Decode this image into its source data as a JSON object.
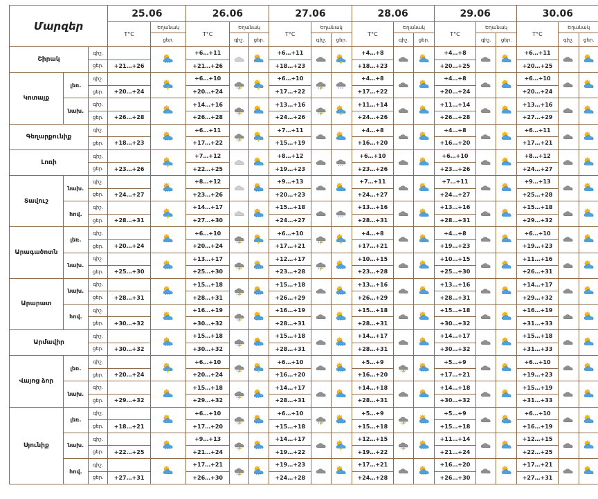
{
  "header": {
    "title": "Մարզեր",
    "days": [
      "25.06",
      "26.06",
      "27.06",
      "28.06",
      "29.06",
      "30.06"
    ],
    "temp_label": "T°C",
    "weather_label": "Եղանակ",
    "night_label": "գիշ.",
    "day_label": "ցեր."
  },
  "icon_names": {
    "s": "sun-behind-cloud-rain-icon",
    "sc": "sun-behind-cloud-icon",
    "c": "cloud-icon",
    "ct": "cloud-lightning-rain-icon",
    "cr": "cloud-rain-icon",
    "cl": "light-cloud-icon",
    "st": "sun-cloud-lightning-icon"
  },
  "rows": [
    {
      "region": "Շիրակ",
      "sub": "",
      "period": "գիշ.",
      "temps": [
        "",
        "+6…+11",
        "+6…+11",
        "+4…+8",
        "+4…+8",
        "+6…+11"
      ],
      "icons": [
        [
          "s"
        ],
        [
          "cl",
          "sc"
        ],
        [
          "c",
          "st"
        ],
        [
          "c",
          "sc"
        ],
        [
          "c",
          "sc"
        ],
        [
          "c",
          "sc"
        ]
      ]
    },
    {
      "region": "",
      "sub": "",
      "period": "ցեր.",
      "temps": [
        "+21…+26",
        "+21…+26",
        "+18…+23",
        "+18…+23",
        "+20…+25",
        "+20…+25"
      ],
      "icons": []
    },
    {
      "region": "Կոտայք",
      "sub": "լեռ.",
      "period": "գիշ.",
      "temps": [
        "",
        "+6…+10",
        "+6…+10",
        "+4…+8",
        "+4…+8",
        "+6…+10"
      ],
      "icons": [
        [
          "st"
        ],
        [
          "ct",
          "st"
        ],
        [
          "ct",
          "cr"
        ],
        [
          "c",
          "sc"
        ],
        [
          "c",
          "sc"
        ],
        [
          "c",
          "sc"
        ]
      ]
    },
    {
      "region": "",
      "sub": "",
      "period": "ցեր.",
      "temps": [
        "+20…+24",
        "+20…+24",
        "+17…+22",
        "+17…+22",
        "+20…+24",
        "+20…+24"
      ],
      "icons": []
    },
    {
      "region": "",
      "sub": "նախ.",
      "period": "գիշ.",
      "temps": [
        "",
        "+14…+16",
        "+13…+16",
        "+11…+14",
        "+11…+14",
        "+13…+16"
      ],
      "icons": [
        [
          "sc"
        ],
        [
          "ct",
          "sc"
        ],
        [
          "ct",
          "st"
        ],
        [
          "c",
          "sc"
        ],
        [
          "c",
          "sc"
        ],
        [
          "c",
          "sc"
        ]
      ]
    },
    {
      "region": "",
      "sub": "",
      "period": "ցեր.",
      "temps": [
        "+26…+28",
        "+26…+28",
        "+24…+26",
        "+24…+26",
        "+26…+28",
        "+27…+29"
      ],
      "icons": []
    },
    {
      "region": "Գեղարքունիք",
      "sub": "",
      "period": "գիշ.",
      "temps": [
        "",
        "+6…+11",
        "+7…+11",
        "+4…+8",
        "+4…+8",
        "+6…+11"
      ],
      "icons": [
        [
          "s"
        ],
        [
          "ct",
          "st"
        ],
        [
          "c",
          "sc"
        ],
        [
          "c",
          "sc"
        ],
        [
          "c",
          "sc"
        ],
        [
          "c",
          "sc"
        ]
      ]
    },
    {
      "region": "",
      "sub": "",
      "period": "ցեր.",
      "temps": [
        "+18…+23",
        "+17…+22",
        "+15…+19",
        "+16…+20",
        "+16…+20",
        "+17…+21"
      ],
      "icons": []
    },
    {
      "region": "Լոռի",
      "sub": "",
      "period": "գիշ.",
      "temps": [
        "",
        "+7…+12",
        "+8…+12",
        "+6…+10",
        "+6…+10",
        "+8…+12"
      ],
      "icons": [
        [
          "st"
        ],
        [
          "cl",
          "sc"
        ],
        [
          "c",
          "cr"
        ],
        [
          "c",
          "sc"
        ],
        [
          "c",
          "sc"
        ],
        [
          "c",
          "sc"
        ]
      ]
    },
    {
      "region": "",
      "sub": "",
      "period": "ցեր.",
      "temps": [
        "+23…+26",
        "+22…+25",
        "+19…+23",
        "+23…+26",
        "+23…+26",
        "+24…+27"
      ],
      "icons": []
    },
    {
      "region": "Տավուշ",
      "sub": "նախ.",
      "period": "գիշ.",
      "temps": [
        "",
        "+8…+12",
        "+9…+13",
        "+7…+11",
        "+7…+11",
        "+9…+13"
      ],
      "icons": [
        [
          "s"
        ],
        [
          "cl",
          "s"
        ],
        [
          "c",
          "sc"
        ],
        [
          "c",
          "sc"
        ],
        [
          "c",
          "sc"
        ],
        [
          "c",
          "sc"
        ]
      ]
    },
    {
      "region": "",
      "sub": "",
      "period": "ցեր.",
      "temps": [
        "+24…+27",
        "+23…+26",
        "+20…+23",
        "+24…+27",
        "+24…+27",
        "+25…+28"
      ],
      "icons": []
    },
    {
      "region": "",
      "sub": "հով.",
      "period": "գիշ.",
      "temps": [
        "",
        "+14…+17",
        "+15…+18",
        "+13…+16",
        "+13…+16",
        "+15…+18"
      ],
      "icons": [
        [
          "st"
        ],
        [
          "cl",
          "s"
        ],
        [
          "c",
          "cr"
        ],
        [
          "c",
          "sc"
        ],
        [
          "c",
          "sc"
        ],
        [
          "c",
          "sc"
        ]
      ]
    },
    {
      "region": "",
      "sub": "",
      "period": "ցեր.",
      "temps": [
        "+28…+31",
        "+27…+30",
        "+24…+27",
        "+28…+31",
        "+28…+31",
        "+29…+32"
      ],
      "icons": []
    },
    {
      "region": "Արագածոտն",
      "sub": "լեռ.",
      "period": "գիշ.",
      "temps": [
        "",
        "+6…+10",
        "+6…+10",
        "+4…+8",
        "+4…+8",
        "+6…+10"
      ],
      "icons": [
        [
          "sc"
        ],
        [
          "ct",
          "st"
        ],
        [
          "ct",
          "st"
        ],
        [
          "c",
          "sc"
        ],
        [
          "c",
          "sc"
        ],
        [
          "c",
          "sc"
        ]
      ]
    },
    {
      "region": "",
      "sub": "",
      "period": "ցեր.",
      "temps": [
        "+20…+24",
        "+20…+24",
        "+17…+21",
        "+17…+21",
        "+19…+23",
        "+19…+23"
      ],
      "icons": []
    },
    {
      "region": "",
      "sub": "նախ.",
      "period": "գիշ.",
      "temps": [
        "",
        "+13…+17",
        "+12…+17",
        "+10…+15",
        "+10…+15",
        "+11…+16"
      ],
      "icons": [
        [
          "s"
        ],
        [
          "ct",
          "s"
        ],
        [
          "ct",
          "s"
        ],
        [
          "c",
          "sc"
        ],
        [
          "c",
          "sc"
        ],
        [
          "c",
          "sc"
        ]
      ]
    },
    {
      "region": "",
      "sub": "",
      "period": "ցեր.",
      "temps": [
        "+25…+30",
        "+25…+30",
        "+23…+28",
        "+23…+28",
        "+25…+30",
        "+26…+31"
      ],
      "icons": []
    },
    {
      "region": "Արարատ",
      "sub": "նախ.",
      "period": "գիշ.",
      "temps": [
        "",
        "+15…+18",
        "+15…+18",
        "+13…+16",
        "+13…+16",
        "+14…+17"
      ],
      "icons": [
        [
          "s"
        ],
        [
          "ct",
          "s"
        ],
        [
          "c",
          "s"
        ],
        [
          "c",
          "sc"
        ],
        [
          "c",
          "sc"
        ],
        [
          "c",
          "sc"
        ]
      ]
    },
    {
      "region": "",
      "sub": "",
      "period": "ցեր.",
      "temps": [
        "+28…+31",
        "+28…+31",
        "+26…+29",
        "+26…+29",
        "+28…+31",
        "+29…+32"
      ],
      "icons": []
    },
    {
      "region": "",
      "sub": "հով.",
      "period": "գիշ.",
      "temps": [
        "",
        "+16…+19",
        "+16…+19",
        "+15…+18",
        "+15…+18",
        "+16…+19"
      ],
      "icons": [
        [
          "sc"
        ],
        [
          "ct",
          "s"
        ],
        [
          "c",
          "s"
        ],
        [
          "c",
          "sc"
        ],
        [
          "c",
          "sc"
        ],
        [
          "c",
          "sc"
        ]
      ]
    },
    {
      "region": "",
      "sub": "",
      "period": "ցեր.",
      "temps": [
        "+30…+32",
        "+30…+32",
        "+28…+31",
        "+28…+31",
        "+30…+32",
        "+31…+33"
      ],
      "icons": []
    },
    {
      "region": "Արմավիր",
      "sub": "",
      "period": "գիշ.",
      "temps": [
        "",
        "+15…+18",
        "+15…+18",
        "+14…+17",
        "+14…+17",
        "+15…+18"
      ],
      "icons": [
        [
          "s"
        ],
        [
          "ct",
          "s"
        ],
        [
          "c",
          "s"
        ],
        [
          "c",
          "sc"
        ],
        [
          "c",
          "sc"
        ],
        [
          "c",
          "sc"
        ]
      ]
    },
    {
      "region": "",
      "sub": "",
      "period": "ցեր.",
      "temps": [
        "+30…+32",
        "+30…+32",
        "+28…+31",
        "+28…+31",
        "+30…+32",
        "+31…+33"
      ],
      "icons": []
    },
    {
      "region": "Վայոց ձոր",
      "sub": "լեռ.",
      "period": "գիշ.",
      "temps": [
        "",
        "+6…+10",
        "+6…+10",
        "+5…+9",
        "+5…+9",
        "+6…+10"
      ],
      "icons": [
        [
          "st"
        ],
        [
          "ct",
          "st"
        ],
        [
          "c",
          "s"
        ],
        [
          "ct",
          "s"
        ],
        [
          "c",
          "sc"
        ],
        [
          "c",
          "sc"
        ]
      ]
    },
    {
      "region": "",
      "sub": "",
      "period": "ցեր.",
      "temps": [
        "+20…+24",
        "+20…+24",
        "+16…+20",
        "+16…+20",
        "+17…+21",
        "+19…+23"
      ],
      "icons": []
    },
    {
      "region": "",
      "sub": "նախ.",
      "period": "գիշ.",
      "temps": [
        "",
        "+15…+18",
        "+14…+17",
        "+14…+18",
        "+14…+18",
        "+15…+19"
      ],
      "icons": [
        [
          "sc"
        ],
        [
          "ct",
          "s"
        ],
        [
          "c",
          "sc"
        ],
        [
          "c",
          "sc"
        ],
        [
          "c",
          "sc"
        ],
        [
          "c",
          "sc"
        ]
      ]
    },
    {
      "region": "",
      "sub": "",
      "period": "ցեր.",
      "temps": [
        "+29…+32",
        "+29…+32",
        "+28…+31",
        "+28…+31",
        "+30…+32",
        "+31…+33"
      ],
      "icons": []
    },
    {
      "region": "Սյունիք",
      "sub": "լեռ.",
      "period": "գիշ.",
      "temps": [
        "",
        "+6…+10",
        "+6…+10",
        "+5…+9",
        "+5…+9",
        "+6…+10"
      ],
      "icons": [
        [
          "sc"
        ],
        [
          "ct",
          "s"
        ],
        [
          "ct",
          "s"
        ],
        [
          "ct",
          "s"
        ],
        [
          "c",
          "s"
        ],
        [
          "c",
          "sc"
        ]
      ]
    },
    {
      "region": "",
      "sub": "",
      "period": "ցեր.",
      "temps": [
        "+18…+21",
        "+17…+20",
        "+15…+18",
        "+15…+18",
        "+15…+18",
        "+16…+19"
      ],
      "icons": []
    },
    {
      "region": "",
      "sub": "նախ.",
      "period": "գիշ.",
      "temps": [
        "",
        "+9…+13",
        "+14…+17",
        "+12…+15",
        "+11…+14",
        "+12…+15"
      ],
      "icons": [
        [
          "s"
        ],
        [
          "ct",
          "s"
        ],
        [
          "c",
          "st"
        ],
        [
          "ct",
          "s"
        ],
        [
          "c",
          "sc"
        ],
        [
          "c",
          "sc"
        ]
      ]
    },
    {
      "region": "",
      "sub": "",
      "period": "ցեր.",
      "temps": [
        "+22…+25",
        "+21…+24",
        "+19…+22",
        "+19…+22",
        "+21…+24",
        "+22…+25"
      ],
      "icons": []
    },
    {
      "region": "",
      "sub": "հով.",
      "period": "գիշ.",
      "temps": [
        "",
        "+17…+21",
        "+19…+23",
        "+17…+21",
        "+16…+20",
        "+17…+21"
      ],
      "icons": [
        [
          "sc"
        ],
        [
          "ct",
          "s"
        ],
        [
          "c",
          "sc"
        ],
        [
          "c",
          "s"
        ],
        [
          "c",
          "sc"
        ],
        [
          "c",
          "sc"
        ]
      ]
    },
    {
      "region": "",
      "sub": "",
      "period": "ցեր.",
      "temps": [
        "+27…+31",
        "+26…+30",
        "+24…+28",
        "+24…+28",
        "+26…+30",
        "+27…+31"
      ],
      "icons": []
    }
  ]
}
